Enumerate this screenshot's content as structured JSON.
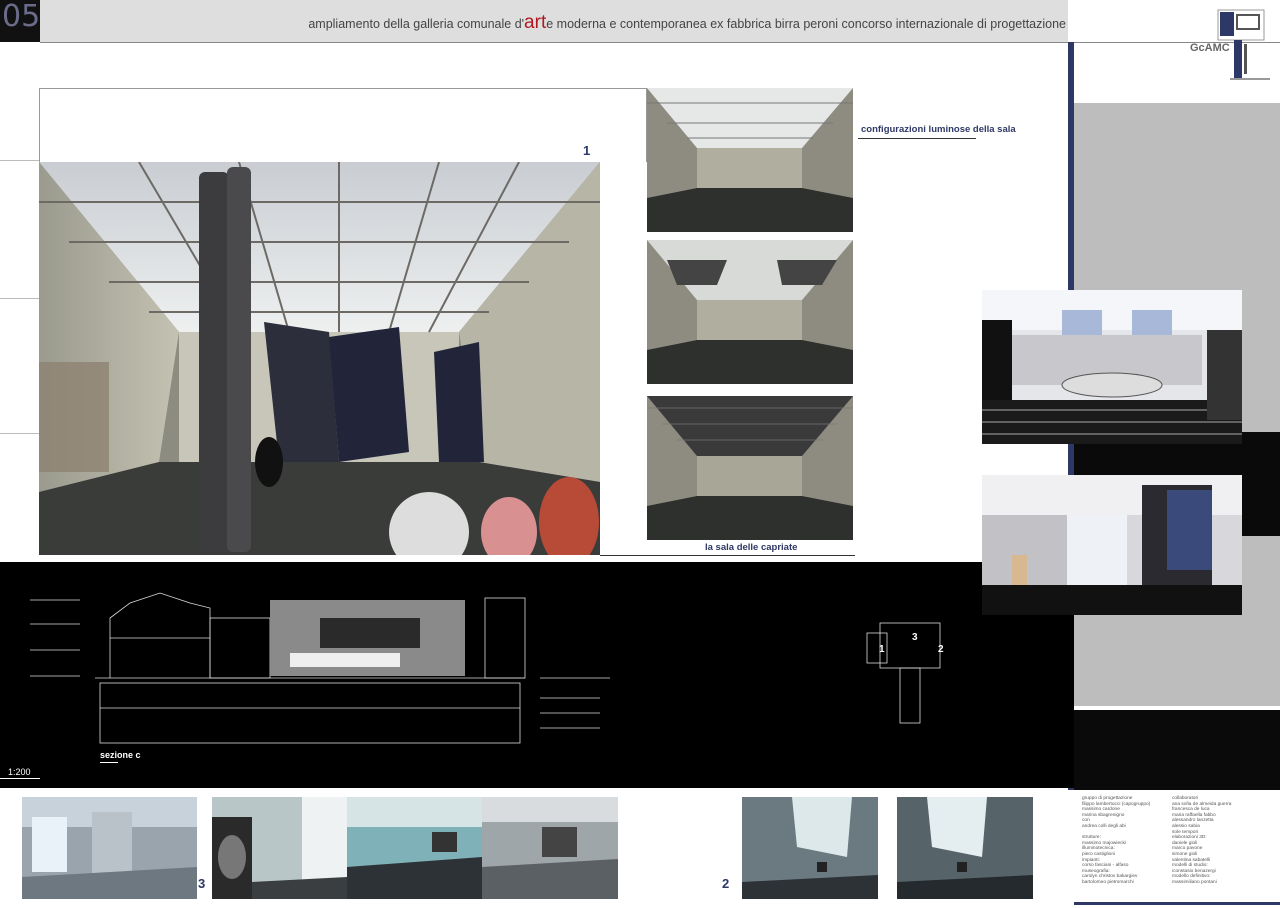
{
  "header": {
    "sheet_number": "05",
    "title_before": "ampliamento della galleria comunale d'",
    "title_highlight": "art",
    "title_after": "e moderna e contemporanea ex fabbrica birra peroni  concorso internazionale di progettazione"
  },
  "logo": {
    "text": "GcAMC"
  },
  "labels": {
    "main_number": "1",
    "configurations": "configurazioni luminose della sala",
    "hall": "la sala delle capriate",
    "section": "sezione c",
    "scale": "1:200",
    "bottom_number_left": "3",
    "bottom_number_right": "2"
  },
  "plan_labels": [
    "1",
    "3",
    "2"
  ],
  "credits": {
    "col1": [
      "gruppo di progettazione",
      "filippo lambertucci (capogruppo)",
      "massimo cardone",
      "marina sbagrenigno",
      "con",
      "andrea colli degli abi",
      "",
      "strutture:",
      "massimo majowiecki",
      "illuminotecnica:",
      "piero castiglioni",
      "impianti:",
      "corso fasciani - alfaso",
      "museografia:",
      "carolyn christov bakargiev",
      "bartolomeo pietromarchi"
    ],
    "col2": [
      "collaboratori",
      "ana sofia de almeida guerra",
      "francesca de luca",
      "maria raffaella fabbo",
      "alessandro lanzetta",
      "alessio sabia",
      "sole tempori",
      "elaborazioni 3D:",
      "daniele gioli",
      "marco pavone",
      "simone gioli",
      "valentina sabatelli",
      "modelli di studio:",
      "iconstasio benazergi",
      "modello definitivo:",
      "massimiliano pontani"
    ]
  },
  "colors": {
    "accent_navy": "#2e3866",
    "accent_red": "#b01820",
    "header_gray": "#dedede"
  }
}
